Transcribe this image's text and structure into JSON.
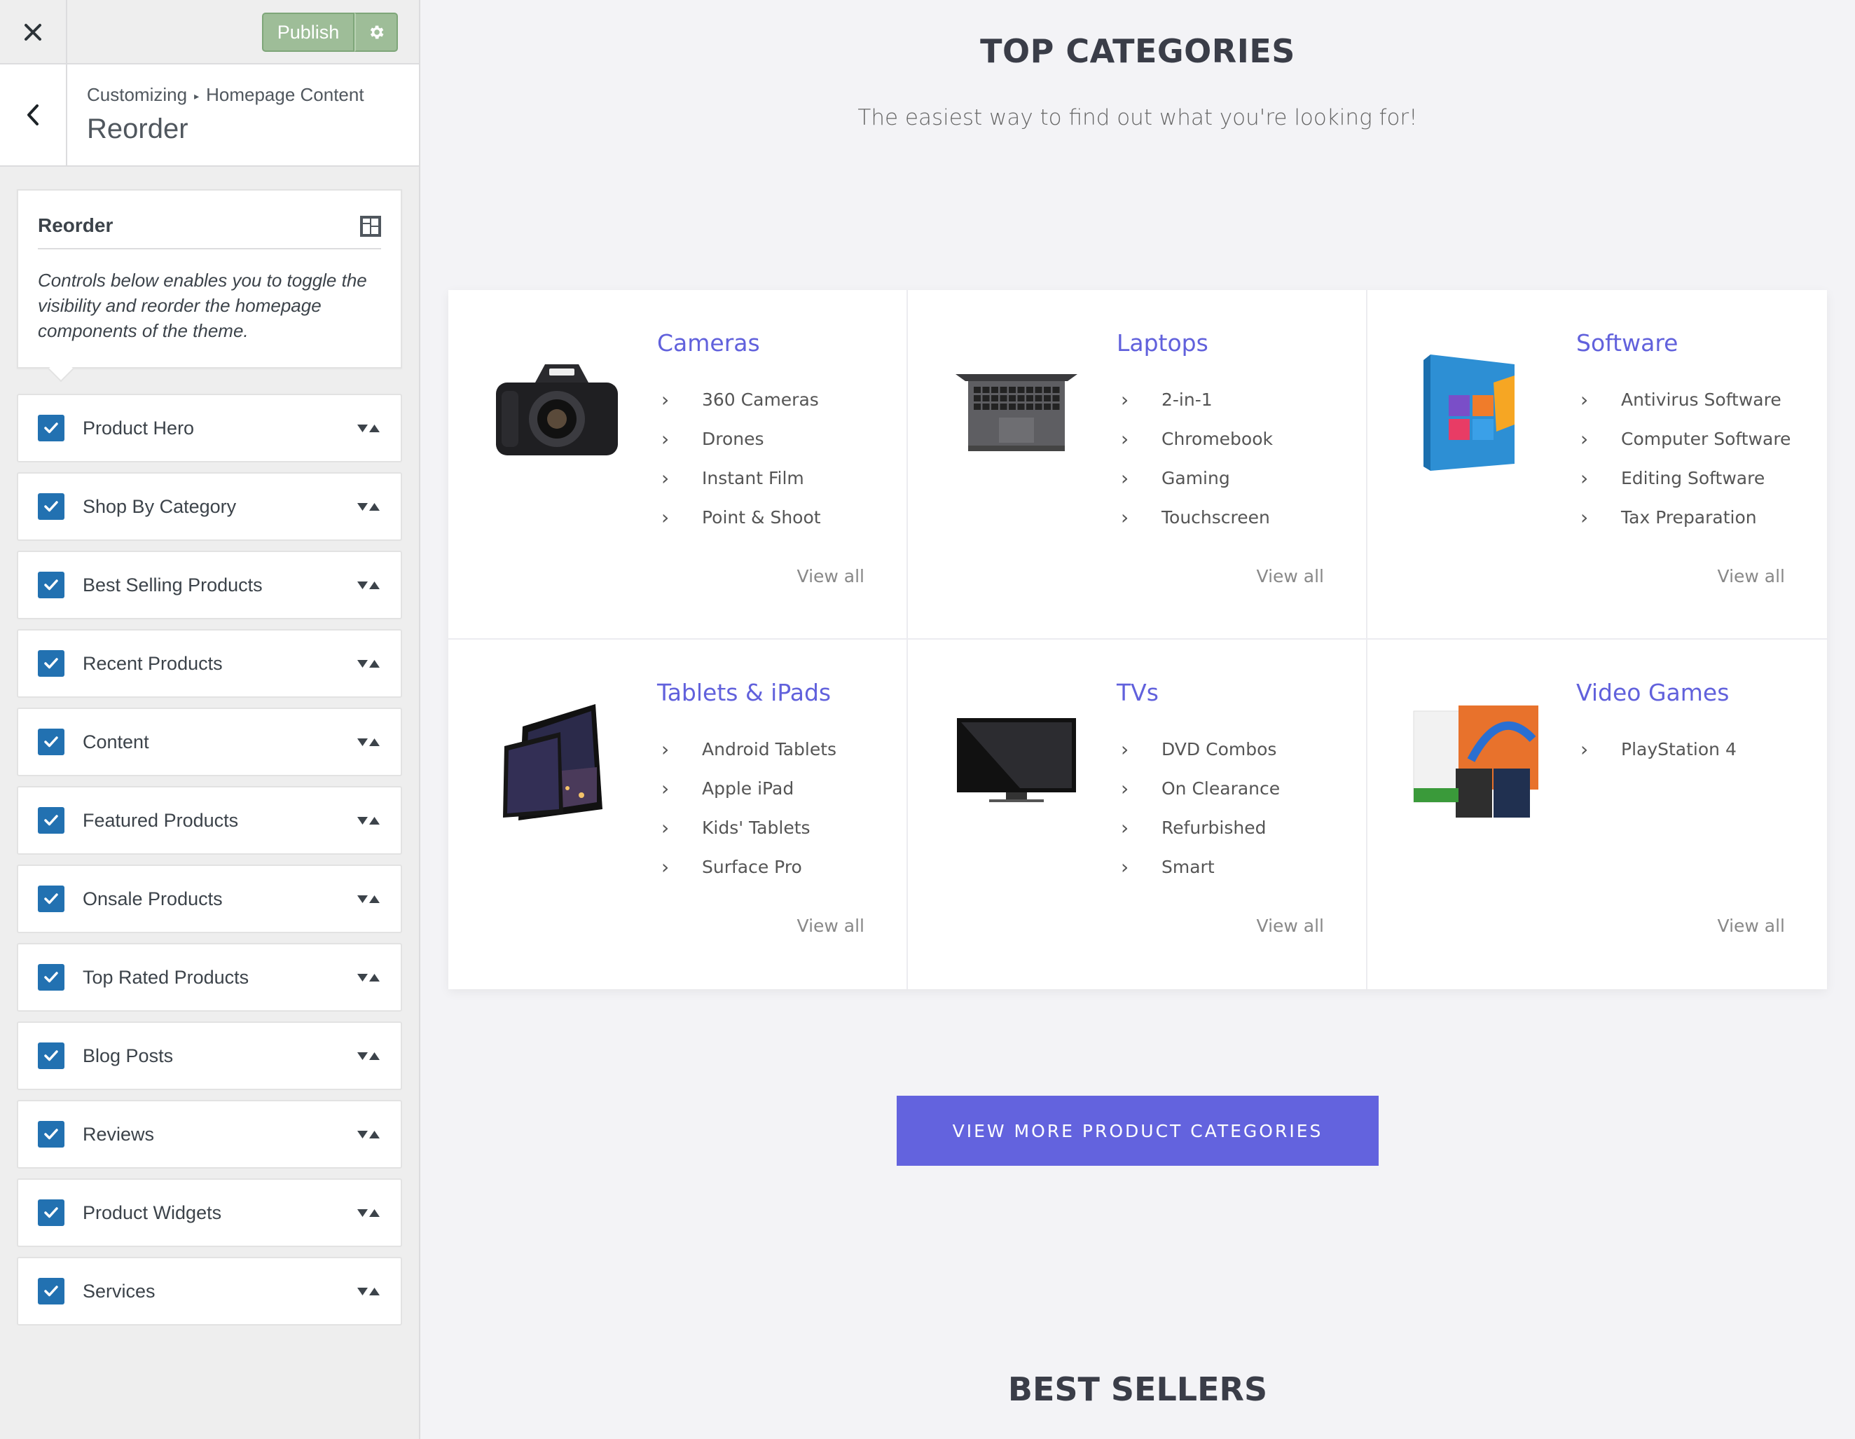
{
  "customizer": {
    "close_icon": "close-icon",
    "publish_label": "Publish",
    "settings_icon": "gear-icon",
    "breadcrumb": [
      "Customizing",
      "Homepage Content"
    ],
    "section_title": "Reorder",
    "info": {
      "title": "Reorder",
      "description": "Controls below enables you to toggle the visibility and reorder the homepage components of the theme."
    },
    "items": [
      {
        "label": "Product Hero",
        "checked": true
      },
      {
        "label": "Shop By Category",
        "checked": true
      },
      {
        "label": "Best Selling Products",
        "checked": true
      },
      {
        "label": "Recent Products",
        "checked": true
      },
      {
        "label": "Content",
        "checked": true
      },
      {
        "label": "Featured Products",
        "checked": true
      },
      {
        "label": "Onsale Products",
        "checked": true
      },
      {
        "label": "Top Rated Products",
        "checked": true
      },
      {
        "label": "Blog Posts",
        "checked": true
      },
      {
        "label": "Reviews",
        "checked": true
      },
      {
        "label": "Product Widgets",
        "checked": true
      },
      {
        "label": "Services",
        "checked": true
      }
    ]
  },
  "preview": {
    "heading": "TOP CATEGORIES",
    "subheading": "The easiest way to find out what you're looking for!",
    "categories": [
      {
        "name": "Cameras",
        "icon": "camera-icon",
        "subs": [
          "360 Cameras",
          "Drones",
          "Instant Film",
          "Point & Shoot"
        ],
        "view_all": "View all"
      },
      {
        "name": "Laptops",
        "icon": "laptop-icon",
        "subs": [
          "2-in-1",
          "Chromebook",
          "Gaming",
          "Touchscreen"
        ],
        "view_all": "View all"
      },
      {
        "name": "Software",
        "icon": "software-box-icon",
        "subs": [
          "Antivirus Software",
          "Computer Software",
          "Editing Software",
          "Tax Preparation"
        ],
        "view_all": "View all"
      },
      {
        "name": "Tablets & iPads",
        "icon": "tablet-icon",
        "subs": [
          "Android Tablets",
          "Apple iPad",
          "Kids' Tablets",
          "Surface Pro"
        ],
        "view_all": "View all"
      },
      {
        "name": "TVs",
        "icon": "tv-icon",
        "subs": [
          "DVD Combos",
          "On Clearance",
          "Refurbished",
          "Smart"
        ],
        "view_all": "View all"
      },
      {
        "name": "Video Games",
        "icon": "game-console-icon",
        "subs": [
          "PlayStation 4"
        ],
        "view_all": "View all"
      }
    ],
    "more_button": "VIEW MORE PRODUCT CATEGORIES",
    "best_heading": "BEST SELLERS"
  },
  "colors": {
    "accent": "#6363de",
    "publish": "#9ebd98",
    "checkbox": "#2271b1"
  }
}
